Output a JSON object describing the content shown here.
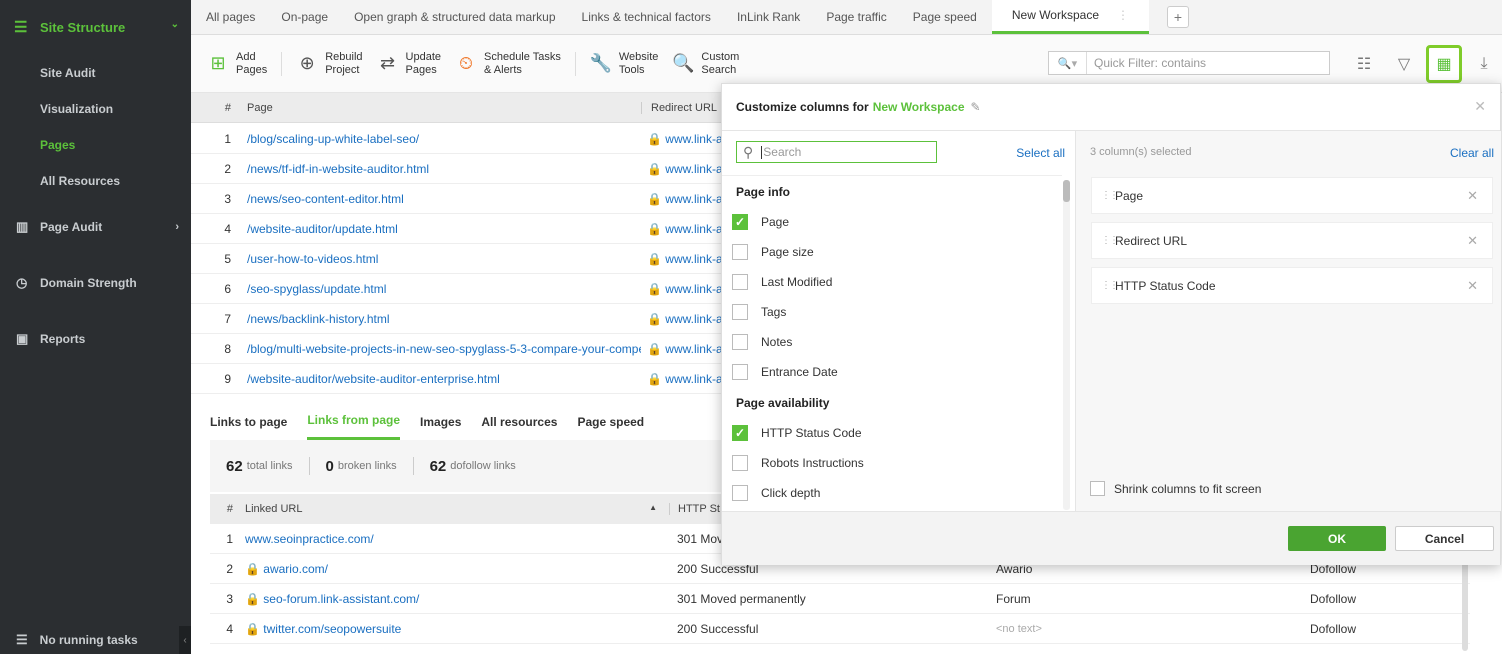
{
  "sidebar": {
    "header": "Site Structure",
    "sub_items": [
      "Site Audit",
      "Visualization",
      "Pages",
      "All Resources"
    ],
    "active_sub": "Pages",
    "sections": [
      "Page Audit",
      "Domain Strength",
      "Reports"
    ],
    "bottom": "No running tasks"
  },
  "tabs": [
    "All pages",
    "On-page",
    "Open graph & structured data markup",
    "Links & technical factors",
    "InLink Rank",
    "Page traffic",
    "Page speed",
    "New Workspace"
  ],
  "toolbar": {
    "add_pages": "Add\nPages",
    "rebuild_project": "Rebuild\nProject",
    "update_pages": "Update\nPages",
    "schedule_tasks": "Schedule Tasks\n& Alerts",
    "website_tools": "Website\nTools",
    "custom_search": "Custom\nSearch",
    "filter_placeholder": "Quick Filter: contains"
  },
  "pages_table": {
    "headers": [
      "#",
      "Page",
      "Redirect URL"
    ],
    "rows": [
      {
        "n": "1",
        "page": "/blog/scaling-up-white-label-seo/",
        "redirect": "🔒 www.link-a"
      },
      {
        "n": "2",
        "page": "/news/tf-idf-in-website-auditor.html",
        "redirect": "🔒 www.link-a"
      },
      {
        "n": "3",
        "page": "/news/seo-content-editor.html",
        "redirect": "🔒 www.link-a"
      },
      {
        "n": "4",
        "page": "/website-auditor/update.html",
        "redirect": "🔒 www.link-a"
      },
      {
        "n": "5",
        "page": "/user-how-to-videos.html",
        "redirect": "🔒 www.link-a"
      },
      {
        "n": "6",
        "page": "/seo-spyglass/update.html",
        "redirect": "🔒 www.link-a"
      },
      {
        "n": "7",
        "page": "/news/backlink-history.html",
        "redirect": "🔒 www.link-a"
      },
      {
        "n": "8",
        "page": "/blog/multi-website-projects-in-new-seo-spyglass-5-3-compare-your-compe",
        "redirect": "🔒 www.link-a"
      },
      {
        "n": "9",
        "page": "/website-auditor/website-auditor-enterprise.html",
        "redirect": "🔒 www.link-a"
      }
    ]
  },
  "bottom_tabs": [
    "Links to page",
    "Links from page",
    "Images",
    "All resources",
    "Page speed"
  ],
  "stats": {
    "total": "62",
    "total_label": "total links",
    "broken": "0",
    "broken_label": "broken links",
    "dofollow": "62",
    "dofollow_label": "dofollow links"
  },
  "links_table": {
    "headers": [
      "#",
      "Linked URL",
      "HTTP St"
    ],
    "rows": [
      {
        "n": "1",
        "url": "www.seoinpractice.com/",
        "status": "301 Mov",
        "anchor": "",
        "follow": ""
      },
      {
        "n": "2",
        "url": "🔒 awario.com/",
        "status": "200 Successful",
        "anchor": "Awario",
        "follow": "Dofollow"
      },
      {
        "n": "3",
        "url": "🔒 seo-forum.link-assistant.com/",
        "status": "301 Moved permanently",
        "anchor": "Forum",
        "follow": "Dofollow"
      },
      {
        "n": "4",
        "url": "🔒 twitter.com/seopowersuite",
        "status": "200 Successful",
        "anchor": "<no text>",
        "follow": "Dofollow"
      }
    ]
  },
  "dialog": {
    "title": "Customize columns for",
    "workspace": "New Workspace",
    "search_placeholder": "Search",
    "select_all": "Select all",
    "groups": [
      {
        "name": "Page info",
        "items": [
          {
            "label": "Page",
            "checked": true
          },
          {
            "label": "Page size",
            "checked": false
          },
          {
            "label": "Last Modified",
            "checked": false
          },
          {
            "label": "Tags",
            "checked": false
          },
          {
            "label": "Notes",
            "checked": false
          },
          {
            "label": "Entrance Date",
            "checked": false
          }
        ]
      },
      {
        "name": "Page availability",
        "items": [
          {
            "label": "HTTP Status Code",
            "checked": true
          },
          {
            "label": "Robots Instructions",
            "checked": false
          },
          {
            "label": "Click depth",
            "checked": false
          }
        ]
      }
    ],
    "selected_count": "3 column(s) selected",
    "clear_all": "Clear all",
    "selected": [
      "Page",
      "Redirect URL",
      "HTTP Status Code"
    ],
    "shrink": "Shrink columns to fit screen",
    "ok": "OK",
    "cancel": "Cancel"
  },
  "colors": {
    "accent": "#5cc13b",
    "link": "#1a6fc1",
    "sidebar": "#2b2e31"
  }
}
